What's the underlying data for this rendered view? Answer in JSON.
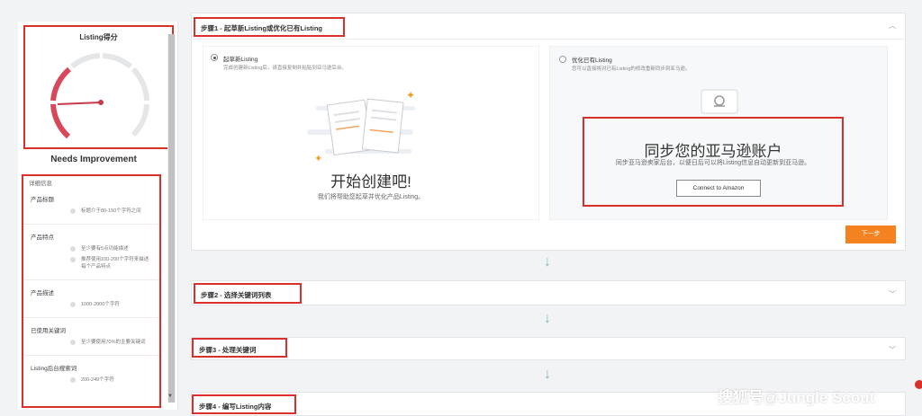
{
  "sidebar": {
    "score_title": "Listing得分",
    "score_label": "Needs Improvement",
    "details_heading": "详细信息",
    "sections": [
      {
        "title": "产品标题",
        "criteria": [
          "标题介于80-150个字符之间"
        ]
      },
      {
        "title": "产品特点",
        "criteria": [
          "至少要有5点功能描述",
          "推荐使用100-200个字符来描述每个产品特点"
        ]
      },
      {
        "title": "产品描述",
        "criteria": [
          "1000-2000个字符"
        ]
      },
      {
        "title": "已使用关键词",
        "criteria": [
          "至少要使用70%的主要关键词"
        ]
      },
      {
        "title": "Listing后台搜索词",
        "criteria": [
          "200-249个字符"
        ]
      }
    ]
  },
  "steps": [
    {
      "label": "步骤1 - 起草新Listing或优化已有Listing"
    },
    {
      "label": "步骤2 - 选择关键词列表"
    },
    {
      "label": "步骤3 - 处理关键词"
    },
    {
      "label": "步骤4 - 编写Listing内容"
    }
  ],
  "option_new": {
    "title": "起草新Listing",
    "subtitle": "完成创建新Listing后，请直接复制并粘贴到亚马逊后台。",
    "heading": "开始创建吧!",
    "description": "我们将帮助您起草并优化产品Listing。"
  },
  "option_existing": {
    "title": "优化已有Listing",
    "subtitle": "您可以直接将对已有Listing的修改重新同步到亚马逊。",
    "heading": "同步您的亚马逊账户",
    "description": "同步亚马逊卖家后台，以便日后可以将Listing信息自动更新到亚马逊。",
    "connect_label": "Connect to Amazon"
  },
  "next_label": "下一步",
  "watermark": "搜狐号@Jungle Scout",
  "colors": {
    "accent": "#f58220",
    "highlight": "#d9302c",
    "gauge_red": "#d9485a"
  }
}
